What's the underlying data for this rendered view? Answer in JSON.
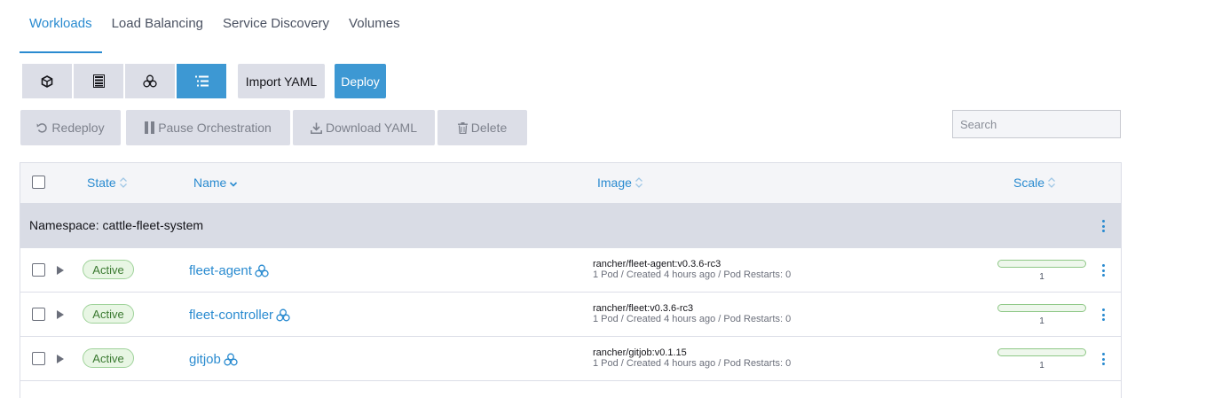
{
  "tabs": [
    {
      "label": "Workloads",
      "active": true
    },
    {
      "label": "Load Balancing",
      "active": false
    },
    {
      "label": "Service Discovery",
      "active": false
    },
    {
      "label": "Volumes",
      "active": false
    }
  ],
  "view_modes": [
    {
      "icon": "cube-icon",
      "active": false
    },
    {
      "icon": "server-list-icon",
      "active": false
    },
    {
      "icon": "cluster-nodes-icon",
      "active": false
    },
    {
      "icon": "list-tree-icon",
      "active": true
    }
  ],
  "toolbar": {
    "import_label": "Import YAML",
    "deploy_label": "Deploy"
  },
  "bulk_actions": {
    "redeploy": "Redeploy",
    "pause": "Pause Orchestration",
    "download": "Download YAML",
    "delete": "Delete"
  },
  "search": {
    "placeholder": "Search",
    "value": ""
  },
  "table": {
    "headers": {
      "state": "State",
      "name": "Name",
      "image": "Image",
      "scale": "Scale"
    },
    "group_label": "Namespace: cattle-fleet-system",
    "rows": [
      {
        "state": "Active",
        "name": "fleet-agent",
        "image": "rancher/fleet-agent:v0.3.6-rc3",
        "details": "1 Pod / Created 4 hours ago / Pod Restarts: 0",
        "scale": "1"
      },
      {
        "state": "Active",
        "name": "fleet-controller",
        "image": "rancher/fleet:v0.3.6-rc3",
        "details": "1 Pod / Created 4 hours ago / Pod Restarts: 0",
        "scale": "1"
      },
      {
        "state": "Active",
        "name": "gitjob",
        "image": "rancher/gitjob:v0.1.15",
        "details": "1 Pod / Created 4 hours ago / Pod Restarts: 0",
        "scale": "1"
      }
    ]
  },
  "colors": {
    "accent": "#2a8bd0",
    "primary_button": "#3d98d3",
    "active_badge_bg": "#e8f6e4",
    "active_badge_text": "#3b7a31",
    "group_bg": "#d9dce5"
  }
}
